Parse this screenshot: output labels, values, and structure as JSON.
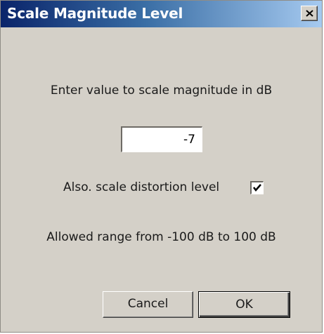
{
  "window": {
    "title": "Scale Magnitude Level"
  },
  "prompt": "Enter value to scale magnitude in dB",
  "input": {
    "value": "-7"
  },
  "scale_distortion": {
    "label": "Also. scale distortion level",
    "checked": true
  },
  "range_text": "Allowed range from -100 dB to 100 dB",
  "buttons": {
    "cancel": "Cancel",
    "ok": "OK"
  },
  "colors": {
    "dialog_bg": "#d4d0c8",
    "title_text": "#ffffff"
  },
  "icons": {
    "close": "close-icon",
    "check": "checkmark-icon"
  }
}
